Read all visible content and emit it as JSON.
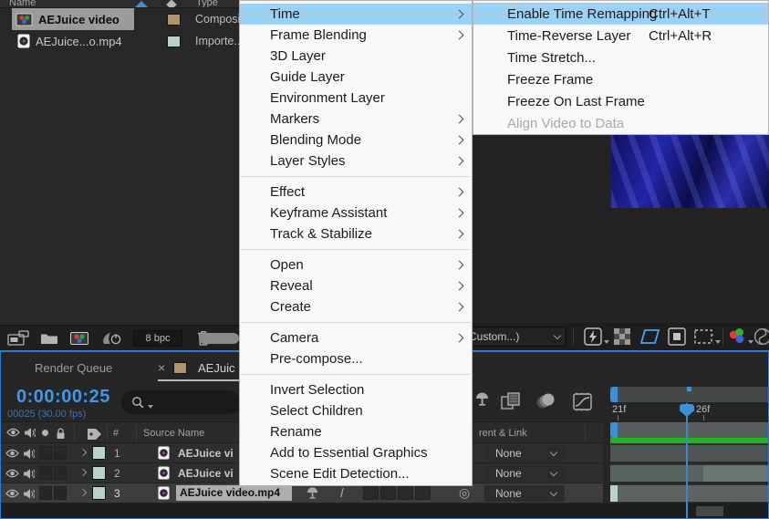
{
  "project_panel": {
    "columns": {
      "name": "Name",
      "type": "Type"
    },
    "rows": [
      {
        "name": "AEJuice video",
        "type": "Composition",
        "label_color": "#ac9372",
        "selected": true
      },
      {
        "name": "AEJuice...o.mp4",
        "type": "Importe...EX",
        "label_color": "#b9d2c9",
        "selected": false
      }
    ],
    "footer": {
      "bit_depth": "8 bpc"
    }
  },
  "context_menu": {
    "items": [
      {
        "label": "Time",
        "has_submenu": true,
        "highlighted": true
      },
      {
        "label": "Frame Blending",
        "has_submenu": true
      },
      {
        "label": "3D Layer"
      },
      {
        "label": "Guide Layer"
      },
      {
        "label": "Environment Layer"
      },
      {
        "label": "Markers",
        "has_submenu": true
      },
      {
        "label": "Blending Mode",
        "has_submenu": true
      },
      {
        "label": "Layer Styles",
        "has_submenu": true
      },
      {
        "label": "Effect",
        "has_submenu": true
      },
      {
        "label": "Keyframe Assistant",
        "has_submenu": true
      },
      {
        "label": "Track & Stabilize",
        "has_submenu": true
      },
      {
        "label": "Open",
        "has_submenu": true
      },
      {
        "label": "Reveal",
        "has_submenu": true
      },
      {
        "label": "Create",
        "has_submenu": true
      },
      {
        "label": "Camera",
        "has_submenu": true
      },
      {
        "label": "Pre-compose..."
      },
      {
        "label": "Invert Selection"
      },
      {
        "label": "Select Children"
      },
      {
        "label": "Rename"
      },
      {
        "label": "Add to Essential Graphics"
      },
      {
        "label": "Scene Edit Detection..."
      }
    ]
  },
  "time_submenu": {
    "items": [
      {
        "label": "Enable Time Remapping",
        "shortcut": "Ctrl+Alt+T",
        "highlighted": true
      },
      {
        "label": "Time-Reverse Layer",
        "shortcut": "Ctrl+Alt+R"
      },
      {
        "label": "Time Stretch..."
      },
      {
        "label": "Freeze Frame"
      },
      {
        "label": "Freeze On Last Frame"
      },
      {
        "label": "Align Video to Data",
        "disabled": true
      }
    ]
  },
  "timeline": {
    "tabs": {
      "render_queue": "Render Queue",
      "close": "×",
      "comp_tab": "AEJuic"
    },
    "timecode": "0:00:00:25",
    "frame_info": "00025 (30.00 fps)",
    "columns": {
      "number": "#",
      "source_name": "Source Name",
      "parent_link": "rent & Link"
    },
    "layers": [
      {
        "number": "1",
        "name": "AEJuice vi",
        "parent": "None"
      },
      {
        "number": "2",
        "name": "AEJuice vi",
        "parent": "None"
      },
      {
        "number": "3",
        "name": "AEJuice video.mp4",
        "parent": "None",
        "selected": true
      }
    ],
    "ruler": {
      "tick_21": "21f",
      "tick_26": "26f"
    }
  },
  "comp_toolbar": {
    "preview_quality": "(Custom...)"
  },
  "icons": {
    "pickwhip": "◎",
    "quality": "/"
  },
  "colors": {
    "accent_blue": "#3e90d8",
    "menu_highlight": "#9dd1f3",
    "render_bar_green": "#23b223",
    "label_tan": "#ac9372",
    "label_mint": "#b9d2c9",
    "panel_border_blue": "#2e7bd2"
  }
}
